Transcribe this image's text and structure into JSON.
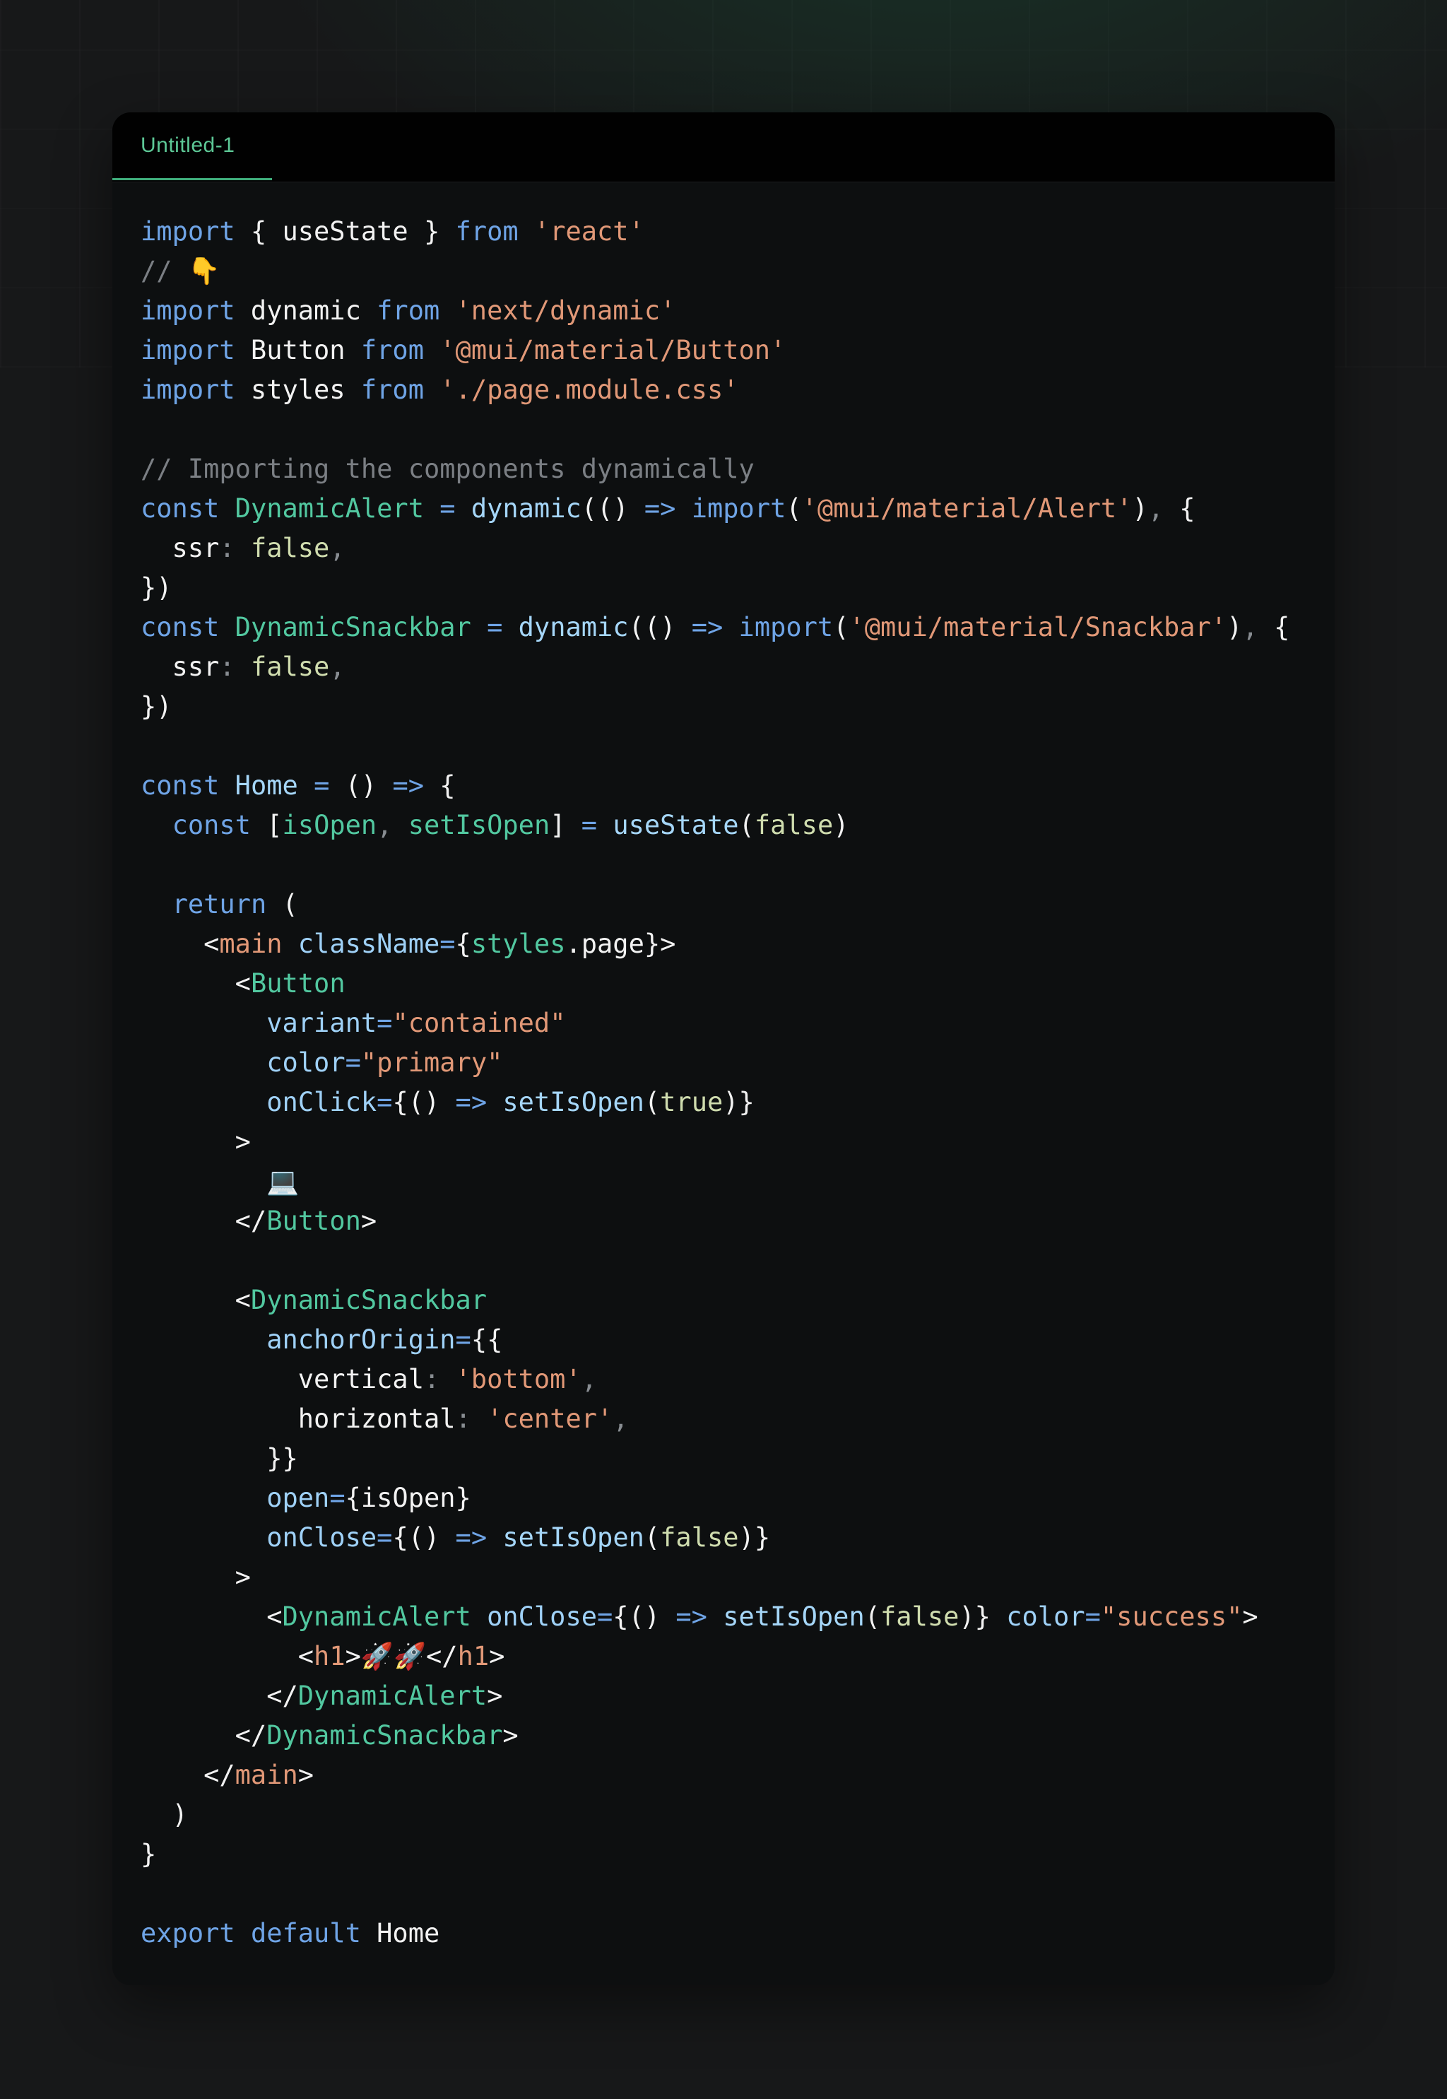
{
  "editor": {
    "tab_label": "Untitled-1",
    "theme_colors": {
      "keyword": "#6fa4e6",
      "string": "#e19877",
      "comment": "#7b7f84",
      "component": "#52c8a0",
      "function": "#a5d6f8",
      "boolean": "#cfdcae",
      "tab_accent": "#3fae7c"
    },
    "lines": [
      [
        [
          "kw",
          "import"
        ],
        [
          "tx",
          " { useState } "
        ],
        [
          "kw",
          "from"
        ],
        [
          "tx",
          " "
        ],
        [
          "str",
          "'react'"
        ]
      ],
      [
        [
          "cm",
          "// "
        ],
        [
          "emoji",
          "👇"
        ]
      ],
      [
        [
          "kw",
          "import"
        ],
        [
          "tx",
          " dynamic "
        ],
        [
          "kw",
          "from"
        ],
        [
          "tx",
          " "
        ],
        [
          "str",
          "'next/dynamic'"
        ]
      ],
      [
        [
          "kw",
          "import"
        ],
        [
          "tx",
          " Button "
        ],
        [
          "kw",
          "from"
        ],
        [
          "tx",
          " "
        ],
        [
          "str",
          "'@mui/material/Button'"
        ]
      ],
      [
        [
          "kw",
          "import"
        ],
        [
          "tx",
          " styles "
        ],
        [
          "kw",
          "from"
        ],
        [
          "tx",
          " "
        ],
        [
          "str",
          "'./page.module.css'"
        ]
      ],
      [],
      [
        [
          "cm",
          "// Importing the components dynamically"
        ]
      ],
      [
        [
          "kw",
          "const"
        ],
        [
          "tx",
          " "
        ],
        [
          "cls",
          "DynamicAlert"
        ],
        [
          "tx",
          " "
        ],
        [
          "op",
          "="
        ],
        [
          "tx",
          " "
        ],
        [
          "fn",
          "dynamic"
        ],
        [
          "tx",
          "(() "
        ],
        [
          "op",
          "=>"
        ],
        [
          "tx",
          " "
        ],
        [
          "kw",
          "import"
        ],
        [
          "tx",
          "("
        ],
        [
          "str",
          "'@mui/material/Alert'"
        ],
        [
          "tx",
          ")"
        ],
        [
          "pn",
          ","
        ],
        [
          "tx",
          " {"
        ]
      ],
      [
        [
          "tx",
          "  ssr"
        ],
        [
          "pn",
          ":"
        ],
        [
          "tx",
          " "
        ],
        [
          "bool",
          "false"
        ],
        [
          "pn",
          ","
        ]
      ],
      [
        [
          "tx",
          "})"
        ]
      ],
      [
        [
          "kw",
          "const"
        ],
        [
          "tx",
          " "
        ],
        [
          "cls",
          "DynamicSnackbar"
        ],
        [
          "tx",
          " "
        ],
        [
          "op",
          "="
        ],
        [
          "tx",
          " "
        ],
        [
          "fn",
          "dynamic"
        ],
        [
          "tx",
          "(() "
        ],
        [
          "op",
          "=>"
        ],
        [
          "tx",
          " "
        ],
        [
          "kw",
          "import"
        ],
        [
          "tx",
          "("
        ],
        [
          "str",
          "'@mui/material/Snackbar'"
        ],
        [
          "tx",
          ")"
        ],
        [
          "pn",
          ","
        ],
        [
          "tx",
          " {"
        ]
      ],
      [
        [
          "tx",
          "  ssr"
        ],
        [
          "pn",
          ":"
        ],
        [
          "tx",
          " "
        ],
        [
          "bool",
          "false"
        ],
        [
          "pn",
          ","
        ]
      ],
      [
        [
          "tx",
          "})"
        ]
      ],
      [],
      [
        [
          "kw",
          "const"
        ],
        [
          "tx",
          " "
        ],
        [
          "fn",
          "Home"
        ],
        [
          "tx",
          " "
        ],
        [
          "op",
          "="
        ],
        [
          "tx",
          " () "
        ],
        [
          "op",
          "=>"
        ],
        [
          "tx",
          " {"
        ]
      ],
      [
        [
          "tx",
          "  "
        ],
        [
          "kw",
          "const"
        ],
        [
          "tx",
          " ["
        ],
        [
          "cls",
          "isOpen"
        ],
        [
          "pn",
          ","
        ],
        [
          "tx",
          " "
        ],
        [
          "cls",
          "setIsOpen"
        ],
        [
          "tx",
          "] "
        ],
        [
          "op",
          "="
        ],
        [
          "tx",
          " "
        ],
        [
          "fn",
          "useState"
        ],
        [
          "tx",
          "("
        ],
        [
          "bool",
          "false"
        ],
        [
          "tx",
          ")"
        ]
      ],
      [],
      [
        [
          "tx",
          "  "
        ],
        [
          "kw",
          "return"
        ],
        [
          "tx",
          " ("
        ]
      ],
      [
        [
          "tx",
          "    <"
        ],
        [
          "tag",
          "main"
        ],
        [
          "tx",
          " "
        ],
        [
          "prop",
          "className"
        ],
        [
          "op",
          "="
        ],
        [
          "tx",
          "{"
        ],
        [
          "cls",
          "styles"
        ],
        [
          "tx",
          ".page}>"
        ]
      ],
      [
        [
          "tx",
          "      <"
        ],
        [
          "cls",
          "Button"
        ]
      ],
      [
        [
          "tx",
          "        "
        ],
        [
          "prop",
          "variant"
        ],
        [
          "op",
          "="
        ],
        [
          "str",
          "\"contained\""
        ]
      ],
      [
        [
          "tx",
          "        "
        ],
        [
          "prop",
          "color"
        ],
        [
          "op",
          "="
        ],
        [
          "str",
          "\"primary\""
        ]
      ],
      [
        [
          "tx",
          "        "
        ],
        [
          "prop",
          "onClick"
        ],
        [
          "op",
          "="
        ],
        [
          "tx",
          "{() "
        ],
        [
          "op",
          "=>"
        ],
        [
          "tx",
          " "
        ],
        [
          "fn",
          "setIsOpen"
        ],
        [
          "tx",
          "("
        ],
        [
          "bool",
          "true"
        ],
        [
          "tx",
          ")}"
        ]
      ],
      [
        [
          "tx",
          "      >"
        ]
      ],
      [
        [
          "tx",
          "        "
        ],
        [
          "emoji",
          "💻"
        ]
      ],
      [
        [
          "tx",
          "      </"
        ],
        [
          "cls",
          "Button"
        ],
        [
          "tx",
          ">"
        ]
      ],
      [],
      [
        [
          "tx",
          "      <"
        ],
        [
          "cls",
          "DynamicSnackbar"
        ]
      ],
      [
        [
          "tx",
          "        "
        ],
        [
          "prop",
          "anchorOrigin"
        ],
        [
          "op",
          "="
        ],
        [
          "tx",
          "{{"
        ]
      ],
      [
        [
          "tx",
          "          vertical"
        ],
        [
          "pn",
          ":"
        ],
        [
          "tx",
          " "
        ],
        [
          "str",
          "'bottom'"
        ],
        [
          "pn",
          ","
        ]
      ],
      [
        [
          "tx",
          "          horizontal"
        ],
        [
          "pn",
          ":"
        ],
        [
          "tx",
          " "
        ],
        [
          "str",
          "'center'"
        ],
        [
          "pn",
          ","
        ]
      ],
      [
        [
          "tx",
          "        }}"
        ]
      ],
      [
        [
          "tx",
          "        "
        ],
        [
          "prop",
          "open"
        ],
        [
          "op",
          "="
        ],
        [
          "tx",
          "{isOpen}"
        ]
      ],
      [
        [
          "tx",
          "        "
        ],
        [
          "prop",
          "onClose"
        ],
        [
          "op",
          "="
        ],
        [
          "tx",
          "{() "
        ],
        [
          "op",
          "=>"
        ],
        [
          "tx",
          " "
        ],
        [
          "fn",
          "setIsOpen"
        ],
        [
          "tx",
          "("
        ],
        [
          "bool",
          "false"
        ],
        [
          "tx",
          ")}"
        ]
      ],
      [
        [
          "tx",
          "      >"
        ]
      ],
      [
        [
          "tx",
          "        <"
        ],
        [
          "cls",
          "DynamicAlert"
        ],
        [
          "tx",
          " "
        ],
        [
          "prop",
          "onClose"
        ],
        [
          "op",
          "="
        ],
        [
          "tx",
          "{() "
        ],
        [
          "op",
          "=>"
        ],
        [
          "tx",
          " "
        ],
        [
          "fn",
          "setIsOpen"
        ],
        [
          "tx",
          "("
        ],
        [
          "bool",
          "false"
        ],
        [
          "tx",
          ")} "
        ],
        [
          "prop",
          "color"
        ],
        [
          "op",
          "="
        ],
        [
          "str",
          "\"success\""
        ],
        [
          "tx",
          ">"
        ]
      ],
      [
        [
          "tx",
          "          <"
        ],
        [
          "tag",
          "h1"
        ],
        [
          "tx",
          ">"
        ],
        [
          "emoji",
          "🚀🚀"
        ],
        [
          "tx",
          "</"
        ],
        [
          "tag",
          "h1"
        ],
        [
          "tx",
          ">"
        ]
      ],
      [
        [
          "tx",
          "        </"
        ],
        [
          "cls",
          "DynamicAlert"
        ],
        [
          "tx",
          ">"
        ]
      ],
      [
        [
          "tx",
          "      </"
        ],
        [
          "cls",
          "DynamicSnackbar"
        ],
        [
          "tx",
          ">"
        ]
      ],
      [
        [
          "tx",
          "    </"
        ],
        [
          "tag",
          "main"
        ],
        [
          "tx",
          ">"
        ]
      ],
      [
        [
          "tx",
          "  )"
        ]
      ],
      [
        [
          "tx",
          "}"
        ]
      ],
      [],
      [
        [
          "kw",
          "export"
        ],
        [
          "tx",
          " "
        ],
        [
          "kw",
          "default"
        ],
        [
          "tx",
          " Home"
        ]
      ]
    ]
  }
}
